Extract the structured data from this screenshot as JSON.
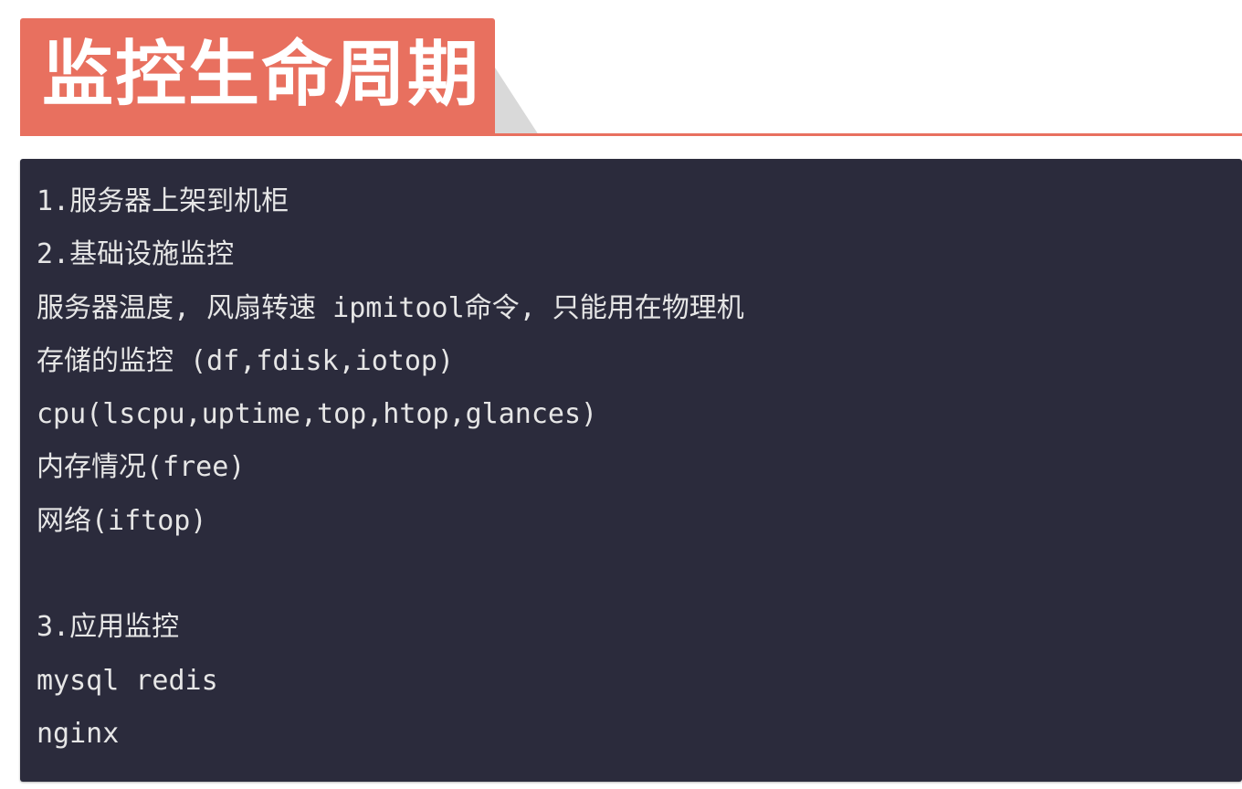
{
  "slide": {
    "title": "监控生命周期",
    "colors": {
      "accent": "#e8705f",
      "panel_background": "#2b2b3c",
      "panel_text": "#e6e6e6",
      "fold_shadow": "#d9d9d9"
    }
  },
  "code_block": {
    "lines": [
      "1.服务器上架到机柜",
      "2.基础设施监控",
      "服务器温度, 风扇转速 ipmitool命令, 只能用在物理机",
      "存储的监控 (df,fdisk,iotop)",
      "cpu(lscpu,uptime,top,htop,glances)",
      "内存情况(free)",
      "网络(iftop)",
      "",
      "3.应用监控",
      "mysql redis",
      "nginx"
    ]
  }
}
